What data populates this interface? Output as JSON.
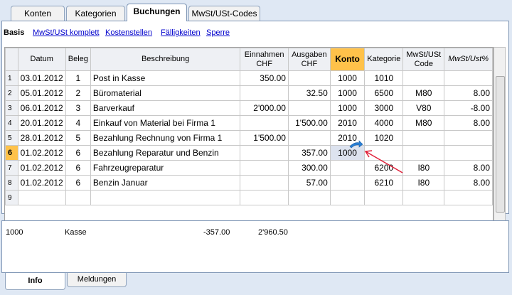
{
  "top_tabs": [
    "Konten",
    "Kategorien",
    "Buchungen",
    "MwSt/USt-Codes"
  ],
  "active_top_tab": "Buchungen",
  "views": [
    "Basis",
    "MwSt/USt komplett",
    "Kostenstellen",
    "Fälligkeiten",
    "Sperre"
  ],
  "columns": {
    "datum": "Datum",
    "beleg": "Beleg",
    "beschreibung": "Beschreibung",
    "einnahmen": "Einnahmen CHF",
    "ausgaben": "Ausgaben CHF",
    "konto": "Konto",
    "kategorie": "Kategorie",
    "mwst_code": "MwSt/USt Code",
    "mwst_pct": "MwSt/Ust%"
  },
  "rows": [
    {
      "n": "1",
      "datum": "03.01.2012",
      "beleg": "1",
      "beschreibung": "Post in Kasse",
      "einnahmen": "350.00",
      "ausgaben": "",
      "konto": "1000",
      "kategorie": "1010",
      "mwst_code": "",
      "mwst_pct": ""
    },
    {
      "n": "2",
      "datum": "05.01.2012",
      "beleg": "2",
      "beschreibung": "Büromaterial",
      "einnahmen": "",
      "ausgaben": "32.50",
      "konto": "1000",
      "kategorie": "6500",
      "mwst_code": "M80",
      "mwst_pct": "8.00"
    },
    {
      "n": "3",
      "datum": "06.01.2012",
      "beleg": "3",
      "beschreibung": "Barverkauf",
      "einnahmen": "2'000.00",
      "ausgaben": "",
      "konto": "1000",
      "kategorie": "3000",
      "mwst_code": "V80",
      "mwst_pct": "-8.00"
    },
    {
      "n": "4",
      "datum": "20.01.2012",
      "beleg": "4",
      "beschreibung": "Einkauf von Material bei Firma 1",
      "einnahmen": "",
      "ausgaben": "1'500.00",
      "konto": "2010",
      "kategorie": "4000",
      "mwst_code": "M80",
      "mwst_pct": "8.00"
    },
    {
      "n": "5",
      "datum": "28.01.2012",
      "beleg": "5",
      "beschreibung": "Bezahlung Rechnung von Firma 1",
      "einnahmen": "1'500.00",
      "ausgaben": "",
      "konto": "2010",
      "kategorie": "1020",
      "mwst_code": "",
      "mwst_pct": ""
    },
    {
      "n": "6",
      "datum": "01.02.2012",
      "beleg": "6",
      "beschreibung": "Bezahlung Reparatur und Benzin",
      "einnahmen": "",
      "ausgaben": "357.00",
      "konto": "1000",
      "kategorie": "",
      "mwst_code": "",
      "mwst_pct": ""
    },
    {
      "n": "7",
      "datum": "01.02.2012",
      "beleg": "6",
      "beschreibung": "Fahrzeugreparatur",
      "einnahmen": "",
      "ausgaben": "300.00",
      "konto": "",
      "kategorie": "6200",
      "mwst_code": "I80",
      "mwst_pct": "8.00"
    },
    {
      "n": "8",
      "datum": "01.02.2012",
      "beleg": "6",
      "beschreibung": "Benzin Januar",
      "einnahmen": "",
      "ausgaben": "57.00",
      "konto": "",
      "kategorie": "6210",
      "mwst_code": "I80",
      "mwst_pct": "8.00"
    },
    {
      "n": "9",
      "datum": "",
      "beleg": "",
      "beschreibung": "",
      "einnahmen": "",
      "ausgaben": "",
      "konto": "",
      "kategorie": "",
      "mwst_code": "",
      "mwst_pct": ""
    }
  ],
  "selected_row": "6",
  "info": {
    "account": "1000",
    "name": "Kasse",
    "amount": "-357.00",
    "balance": "2'960.50"
  },
  "bottom_tabs": [
    "Info",
    "Meldungen"
  ],
  "active_bottom_tab": "Info",
  "colors": {
    "konto_header": "#ffc24a",
    "selected_row_number": "#ffc24a",
    "annotation_arrow": "#e0213a",
    "move_icon": "#2a7fd4"
  },
  "icons": {
    "scroll_grip": "grip-icon",
    "move_cursor": "move-arrow-icon",
    "annotation": "red-annotation-arrow"
  }
}
